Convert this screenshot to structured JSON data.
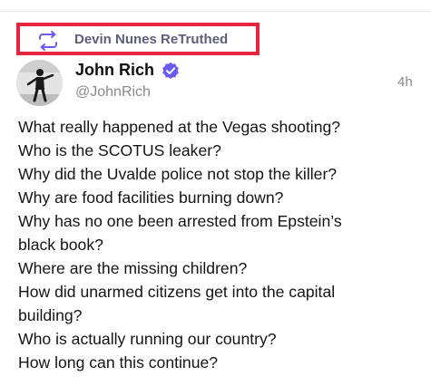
{
  "retruth": {
    "label": "Devin Nunes ReTruthed",
    "icon": "retruth-arrows-icon",
    "highlight_color": "#e8243f"
  },
  "author": {
    "name": "John Rich",
    "handle": "@JohnRich",
    "verified": true,
    "verified_color": "#6b5cf0",
    "avatar_icon": "avatar-photo"
  },
  "post": {
    "timestamp": "4h",
    "lines": [
      "What really happened at the Vegas shooting?",
      "Who is the SCOTUS leaker?",
      "Why did the Uvalde police not stop the killer?",
      "Why are food facilities burning down?",
      "Why has no one been arrested from Epstein’s",
      "black book?",
      "Where are the missing children?",
      "How did unarmed citizens get into the capital",
      "building?",
      "Who is actually running our country?",
      "How long can this continue?"
    ]
  }
}
